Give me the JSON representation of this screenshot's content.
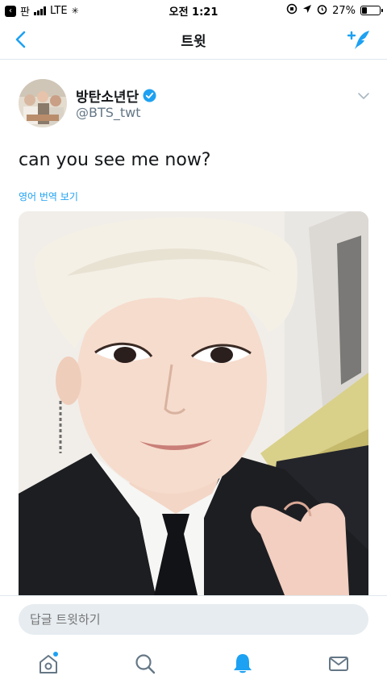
{
  "status_bar": {
    "back_app_label": "판",
    "carrier": "LTE",
    "time": "오전 1:21",
    "battery_percent": "27%",
    "battery_level": 0.27
  },
  "nav": {
    "title": "트윗",
    "back_icon": "chevron-left-icon",
    "compose_icon": "compose-tweet-icon"
  },
  "tweet": {
    "author_name": "방탄소년단",
    "author_handle": "@BTS_twt",
    "text": "can you see me now?",
    "translate_label": "영어 번역 보기",
    "verified": true
  },
  "reply": {
    "placeholder": "답글 트윗하기"
  },
  "tab_bar": {
    "items": [
      {
        "name": "home-icon",
        "active": false,
        "has_dot": true
      },
      {
        "name": "search-icon",
        "active": false
      },
      {
        "name": "notifications-icon",
        "active": true
      },
      {
        "name": "messages-icon",
        "active": false
      }
    ]
  },
  "colors": {
    "accent": "#1da1f2",
    "text": "#14171a",
    "secondary_text": "#657786",
    "divider": "#e1e8ed",
    "input_bg": "#e6ecf0"
  }
}
